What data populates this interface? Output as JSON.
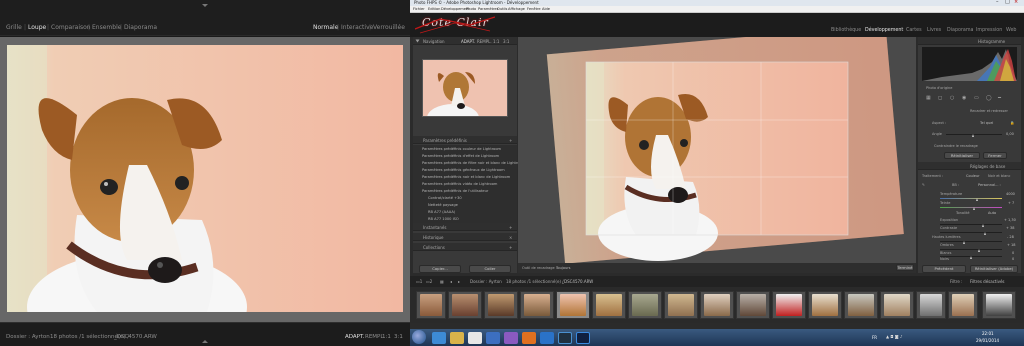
{
  "left_window": {
    "modules": [
      "Grille",
      "Loupe",
      "Comparaison",
      "Ensemble",
      "Diaporama"
    ],
    "active_module": "Loupe",
    "view_modes": [
      "Normale",
      "Interactive",
      "Verrouillée"
    ],
    "active_view_mode": "Normale",
    "bottom": {
      "folder": "Dossier : Ayrton",
      "count": "18 photos /1 sélectionné(e) /",
      "filename": "_DSC4570.ARW",
      "zoom_options": [
        "ADAPT.",
        "REMPL.",
        "1:1",
        "3:1"
      ],
      "active_zoom": "ADAPT."
    }
  },
  "right_window": {
    "title": "Photo FHPS © - Adobe Photoshop Lightroom - Développement",
    "menu": [
      "Fichier",
      "Edition",
      "Développement",
      "Photo",
      "Paramètres",
      "Outils",
      "Affichage",
      "Fenêtre",
      "Aide"
    ],
    "identity_plate": "Cote Clair",
    "modules": [
      "Bibliothèque",
      "Développement",
      "Cartes",
      "Livres",
      "Diaporama",
      "Impression",
      "Web"
    ],
    "active_module": "Développement",
    "navigator": {
      "title": "Navigation",
      "zoom_options": [
        "ADAPT.",
        "REMPL.",
        "1:1",
        "3:1"
      ]
    },
    "presets": {
      "title": "Paramètres prédéfinis",
      "items": [
        "Paramètres prédéfinis couleur de Lightroom",
        "Paramètres prédéfinis d'effet de Lightroom",
        "Paramètres prédéfinis de filtre noir et blanc de Lightroom",
        "Paramètres prédéfinis généraux de Lightroom",
        "Paramètres prédéfinis noir et blanc de Lightroom",
        "Paramètres prédéfinis vidéo de Lightroom",
        "Paramètres prédéfinis de l'utilisateur"
      ],
      "user_items": [
        "Contrat/clarté +30",
        "Netteté paysage",
        "RB A77 (AAAA)",
        "RB A77 1000 ISO",
        "RB A77 1600 ISO"
      ]
    },
    "collapsed_panels": [
      "Instantanés",
      "Historique",
      "Collections"
    ],
    "left_buttons": [
      "Copier...",
      "Coller"
    ],
    "toolbar": {
      "label": "Outil de recadrage :",
      "value": "Toujours"
    },
    "histogram": {
      "title": "Histogramme",
      "original_label": "Photo d'origine"
    },
    "crop": {
      "title": "Recadrer et redresser",
      "aspect_label": "Aspect :",
      "aspect_value": "Tel quel",
      "angle_label": "Angle",
      "angle_value": "0,00",
      "constrain_label": "Contraindre le recadrage",
      "reset_button": "Réinitialiser",
      "close_button": "Fermer"
    },
    "basic": {
      "title": "Réglages de base",
      "treatment_label": "Traitement :",
      "treatment_options": [
        "Couleur",
        "Noir et blanc"
      ],
      "wb_label": "BB :",
      "wb_value": "Personnal... :",
      "temp_label": "Température",
      "temp_value": "4000",
      "tint_label": "Teinte",
      "tint_value": "+ 7",
      "tone_label": "Tonalité",
      "auto_label": "Auto",
      "exposure_label": "Exposition",
      "exposure_value": "+ 1,30",
      "contrast_label": "Contraste",
      "contrast_value": "+ 38",
      "highlights_label": "Hautes lumières",
      "highlights_value": "- 28",
      "shadows_label": "Ombres",
      "shadows_value": "+ 18",
      "whites_label": "Blancs",
      "whites_value": "0",
      "blacks_label": "Noirs",
      "blacks_value": "0"
    },
    "right_buttons": [
      "Précédent",
      "Réinitialiser (Adobe)"
    ],
    "done_button": "Terminé",
    "filmstrip": {
      "folder": "Dossier : Ayrton",
      "count": "18 photos /1 sélectionné(e) /",
      "filename": "_DSC4570.ARW",
      "filter_label": "Filtre :",
      "filter_value": "Filtres désactivés"
    },
    "taskbar": {
      "lang": "FR",
      "time": "22:01",
      "date": "29/01/2014"
    }
  },
  "colors": {
    "left_bg": "#1a1a1a",
    "right_panel": "#393939",
    "accent_active": "#e6e6e6",
    "taskbar": "#27405e"
  }
}
